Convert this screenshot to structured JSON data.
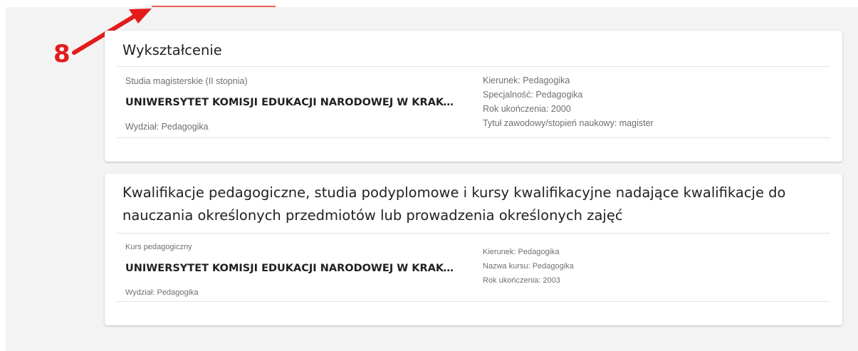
{
  "annotation": {
    "number": "8"
  },
  "colors": {
    "accent_tab": "#e8634f",
    "annotation_red": "#e41b1b",
    "page_background": "#f3f3f3",
    "card_background": "#ffffff"
  },
  "sections": [
    {
      "title": "Wykształcenie",
      "entry": {
        "degree": "Studia magisterskie (II stopnia)",
        "university": "UNIWERSYTET KOMISJI EDUKACJI NARODOWEJ W KRAKO...",
        "faculty": "Wydział: Pedagogika",
        "details": [
          "Kierunek: Pedagogika",
          "Specjalność: Pedagogika",
          "Rok ukończenia: 2000",
          "Tytuł zawodowy/stopień naukowy: magister"
        ]
      }
    },
    {
      "title": "Kwalifikacje pedagogiczne, studia podyplomowe i kursy kwalifikacyjne nadające kwalifikacje do nauczania określonych przedmiotów lub prowadzenia określonych zajęć",
      "entry": {
        "degree": "Kurs pedagogiczny",
        "university": "UNIWERSYTET KOMISJI EDUKACJI NARODOWEJ W KRAKO...",
        "faculty": "Wydział: Pedagogika",
        "details": [
          "Kierunek: Pedagogika",
          "Nazwa kursu: Pedagogika",
          "Rok ukończenia: 2003"
        ]
      }
    }
  ]
}
